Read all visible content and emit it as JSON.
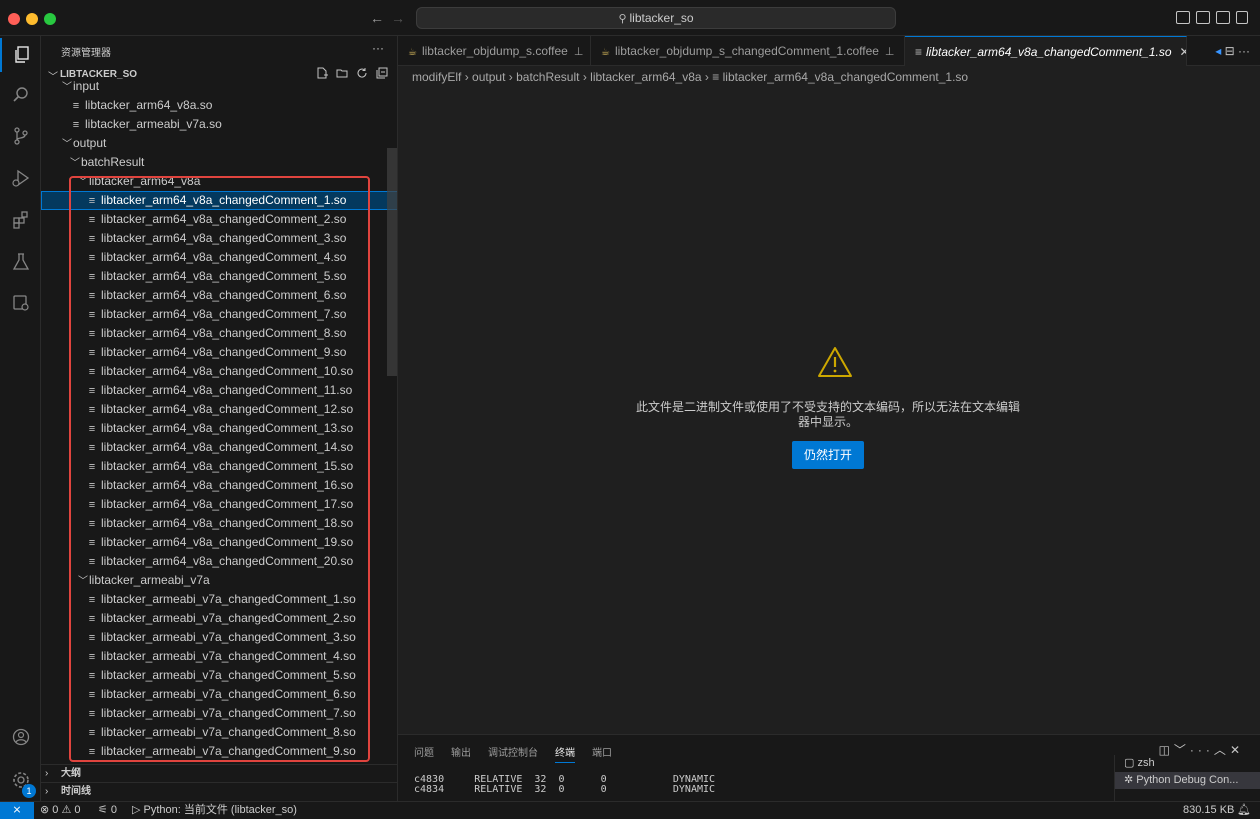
{
  "titlebar": {
    "search_text": "libtacker_so",
    "traffic_colors": [
      "#ff5f57",
      "#febc2e",
      "#28c840"
    ]
  },
  "activity": {
    "icons": [
      "explorer-icon",
      "search-icon",
      "source-control-icon",
      "run-debug-icon",
      "extensions-icon",
      "testing-icon",
      "remote-explorer-icon"
    ],
    "bottom_icons": [
      "account-icon",
      "manage-icon"
    ],
    "manage_badge": "1"
  },
  "sidebar": {
    "title": "资源管理器",
    "more": "···",
    "root": "LIBTACKER_SO",
    "tree": [
      {
        "label": "input",
        "type": "folder",
        "depth": 1,
        "open": true
      },
      {
        "label": "libtacker_arm64_v8a.so",
        "type": "file",
        "depth": 2
      },
      {
        "label": "libtacker_armeabi_v7a.so",
        "type": "file",
        "depth": 2
      },
      {
        "label": "output",
        "type": "folder",
        "depth": 1,
        "open": true
      },
      {
        "label": "batchResult",
        "type": "folder",
        "depth": 2,
        "open": true
      },
      {
        "label": "libtacker_arm64_v8a",
        "type": "folder",
        "depth": 3,
        "open": true
      },
      {
        "label": "libtacker_arm64_v8a_changedComment_1.so",
        "type": "file",
        "depth": 4,
        "selected": true
      },
      {
        "label": "libtacker_arm64_v8a_changedComment_2.so",
        "type": "file",
        "depth": 4
      },
      {
        "label": "libtacker_arm64_v8a_changedComment_3.so",
        "type": "file",
        "depth": 4
      },
      {
        "label": "libtacker_arm64_v8a_changedComment_4.so",
        "type": "file",
        "depth": 4
      },
      {
        "label": "libtacker_arm64_v8a_changedComment_5.so",
        "type": "file",
        "depth": 4
      },
      {
        "label": "libtacker_arm64_v8a_changedComment_6.so",
        "type": "file",
        "depth": 4
      },
      {
        "label": "libtacker_arm64_v8a_changedComment_7.so",
        "type": "file",
        "depth": 4
      },
      {
        "label": "libtacker_arm64_v8a_changedComment_8.so",
        "type": "file",
        "depth": 4
      },
      {
        "label": "libtacker_arm64_v8a_changedComment_9.so",
        "type": "file",
        "depth": 4
      },
      {
        "label": "libtacker_arm64_v8a_changedComment_10.so",
        "type": "file",
        "depth": 4
      },
      {
        "label": "libtacker_arm64_v8a_changedComment_11.so",
        "type": "file",
        "depth": 4
      },
      {
        "label": "libtacker_arm64_v8a_changedComment_12.so",
        "type": "file",
        "depth": 4
      },
      {
        "label": "libtacker_arm64_v8a_changedComment_13.so",
        "type": "file",
        "depth": 4
      },
      {
        "label": "libtacker_arm64_v8a_changedComment_14.so",
        "type": "file",
        "depth": 4
      },
      {
        "label": "libtacker_arm64_v8a_changedComment_15.so",
        "type": "file",
        "depth": 4
      },
      {
        "label": "libtacker_arm64_v8a_changedComment_16.so",
        "type": "file",
        "depth": 4
      },
      {
        "label": "libtacker_arm64_v8a_changedComment_17.so",
        "type": "file",
        "depth": 4
      },
      {
        "label": "libtacker_arm64_v8a_changedComment_18.so",
        "type": "file",
        "depth": 4
      },
      {
        "label": "libtacker_arm64_v8a_changedComment_19.so",
        "type": "file",
        "depth": 4
      },
      {
        "label": "libtacker_arm64_v8a_changedComment_20.so",
        "type": "file",
        "depth": 4
      },
      {
        "label": "libtacker_armeabi_v7a",
        "type": "folder",
        "depth": 3,
        "open": true
      },
      {
        "label": "libtacker_armeabi_v7a_changedComment_1.so",
        "type": "file",
        "depth": 4
      },
      {
        "label": "libtacker_armeabi_v7a_changedComment_2.so",
        "type": "file",
        "depth": 4
      },
      {
        "label": "libtacker_armeabi_v7a_changedComment_3.so",
        "type": "file",
        "depth": 4
      },
      {
        "label": "libtacker_armeabi_v7a_changedComment_4.so",
        "type": "file",
        "depth": 4
      },
      {
        "label": "libtacker_armeabi_v7a_changedComment_5.so",
        "type": "file",
        "depth": 4
      },
      {
        "label": "libtacker_armeabi_v7a_changedComment_6.so",
        "type": "file",
        "depth": 4
      },
      {
        "label": "libtacker_armeabi_v7a_changedComment_7.so",
        "type": "file",
        "depth": 4
      },
      {
        "label": "libtacker_armeabi_v7a_changedComment_8.so",
        "type": "file",
        "depth": 4
      },
      {
        "label": "libtacker_armeabi_v7a_changedComment_9.so",
        "type": "file",
        "depth": 4
      }
    ],
    "outline_label": "大纲",
    "timeline_label": "时间线",
    "highlight_color": "#e0443e"
  },
  "tabs": [
    {
      "label": "libtacker_objdump_s.coffee",
      "pinned": true
    },
    {
      "label": "libtacker_objdump_s_changedComment_1.coffee",
      "pinned": true
    },
    {
      "label": "libtacker_arm64_v8a_changedComment_1.so",
      "active": true
    }
  ],
  "breadcrumbs": [
    "modifyElf",
    "output",
    "batchResult",
    "libtacker_arm64_v8a",
    "libtacker_arm64_v8a_changedComment_1.so"
  ],
  "editor": {
    "message_line1": "此文件是二进制文件或使用了不受支持的文本编码，所以无法在文本编辑",
    "message_line2": "器中显示。",
    "open_button": "仍然打开",
    "warning_color": "#cca700"
  },
  "panel": {
    "tabs": [
      "问题",
      "输出",
      "调试控制台",
      "终端",
      "端口"
    ],
    "active_tab": "终端",
    "terminal_lines": [
      [
        "c4830",
        "RELATIVE",
        "32",
        "0",
        "0",
        "DYNAMIC"
      ],
      [
        "c4834",
        "RELATIVE",
        "32",
        "0",
        "0",
        "DYNAMIC"
      ]
    ],
    "terminals": [
      {
        "label": "zsh"
      },
      {
        "label": "Python Debug Con...",
        "selected": true
      }
    ]
  },
  "status": {
    "errors": "0",
    "warnings": "0",
    "ports": "0",
    "python": "Python: 当前文件 (libtacker_so)",
    "size": "830.15 KB",
    "accent": "#0078d4"
  }
}
